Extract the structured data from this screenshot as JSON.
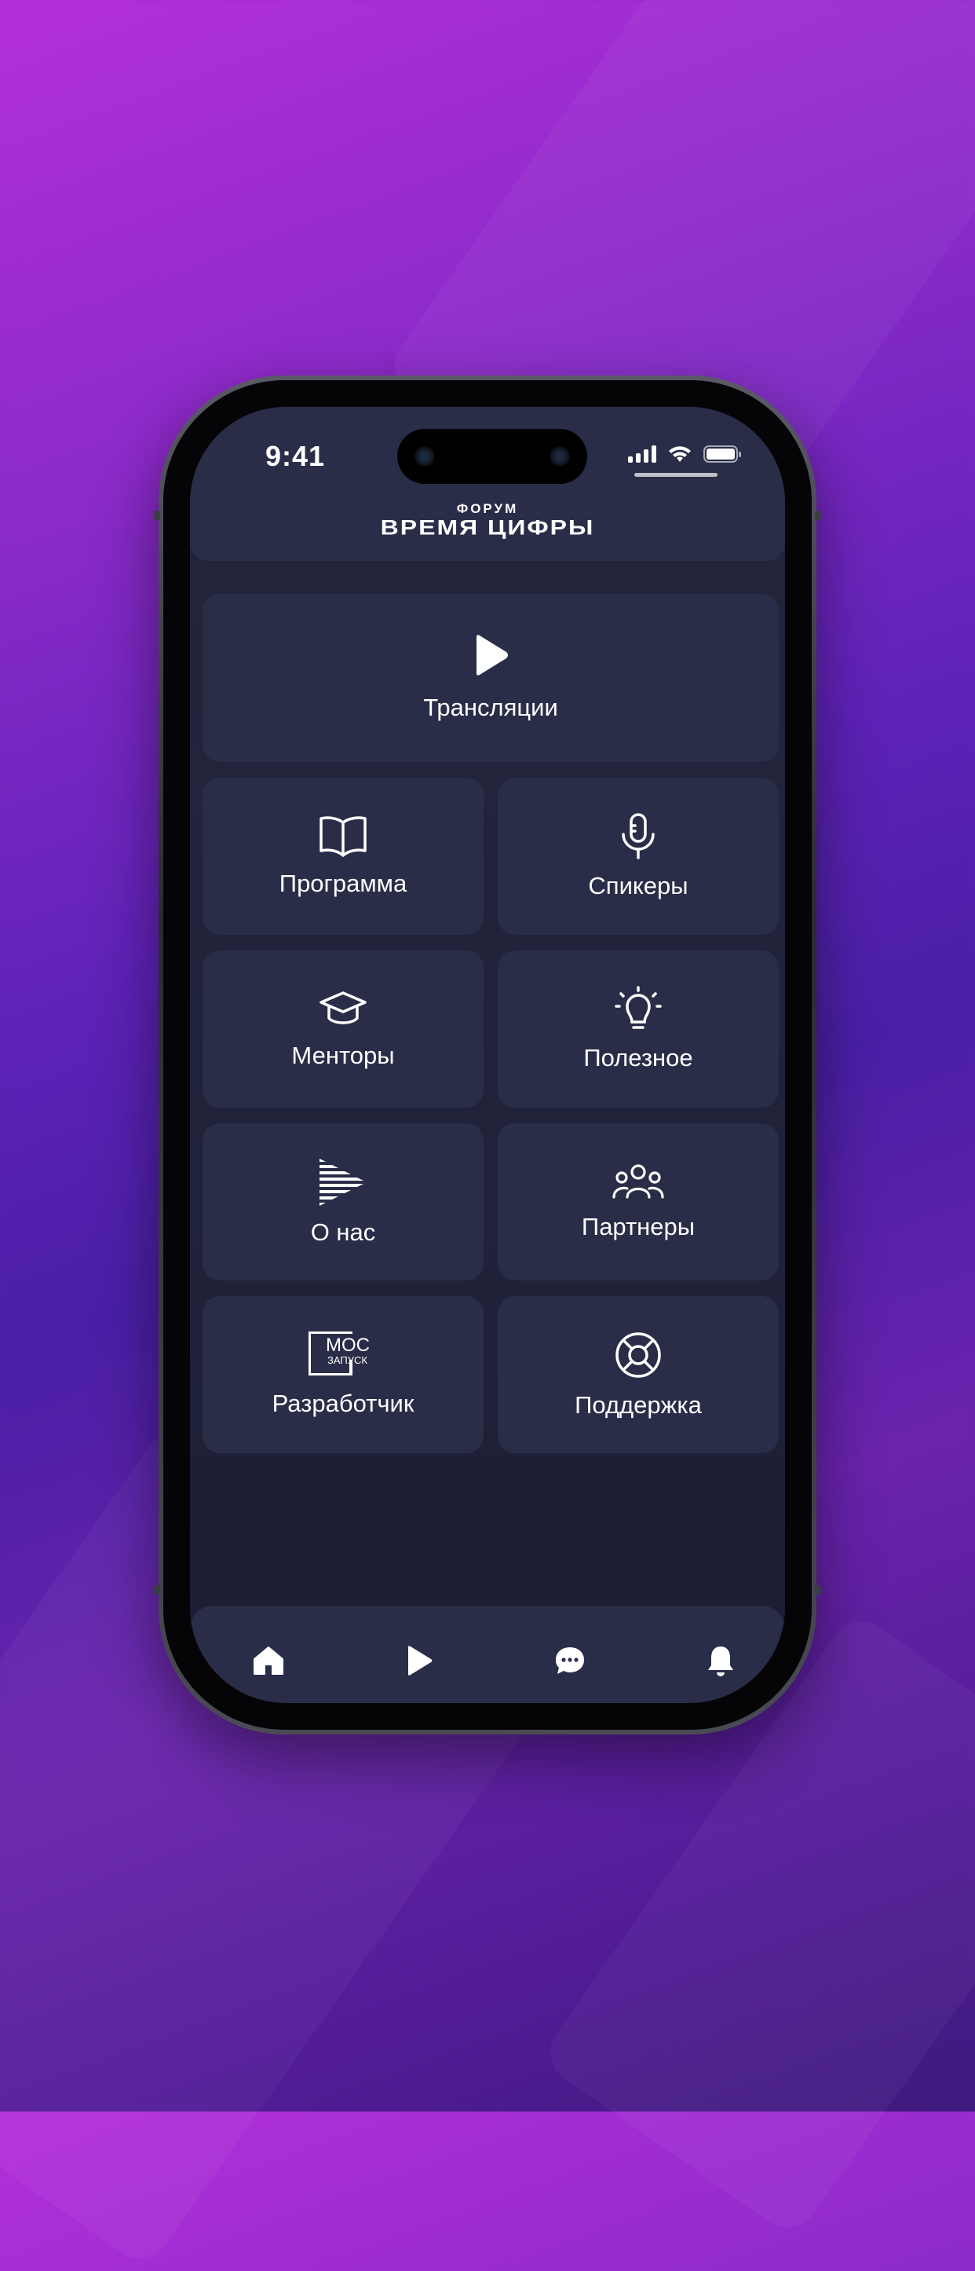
{
  "status_bar": {
    "time": "9:41"
  },
  "header": {
    "logo_small": "ФОРУМ",
    "logo_big": "ВРЕМЯ ЦИФРЫ"
  },
  "tiles": {
    "broadcasts": "Трансляции",
    "program": "Программа",
    "speakers": "Спикеры",
    "mentors": "Менторы",
    "useful": "Полезное",
    "about": "О нас",
    "partners": "Партнеры",
    "developer": "Разработчик",
    "developer_logo_top": "МОС",
    "developer_logo_bottom": "ЗАПУСК",
    "support": "Поддержка"
  },
  "tabbar": {
    "icons": [
      "home-icon",
      "play-icon",
      "chat-icon",
      "bell-icon"
    ]
  },
  "colors": {
    "tile_bg": "#2a2d48",
    "screen_bg": "#20223a",
    "background_gradient_top": "#b32fd9",
    "background_gradient_mid": "#4a1fa6"
  }
}
